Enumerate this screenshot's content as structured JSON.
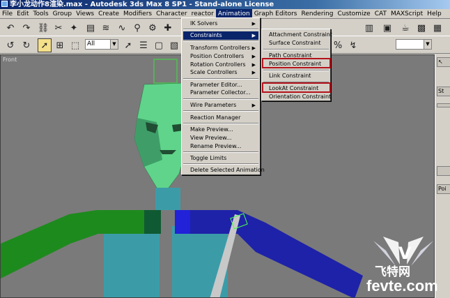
{
  "window": {
    "title": "李小龙动作8渲染.max - Autodesk 3ds Max 8 SP1 - Stand-alone License"
  },
  "menubar": {
    "items": [
      "File",
      "Edit",
      "Tools",
      "Group",
      "Views",
      "Create",
      "Modifiers",
      "Character",
      "reactor",
      "Animation",
      "Graph Editors",
      "Rendering",
      "Customize",
      "CAT",
      "MAXScript",
      "Help"
    ],
    "active": "Animation"
  },
  "toolbar": {
    "selection_filter": "All"
  },
  "viewport": {
    "label": "Front"
  },
  "animation_menu": {
    "items": [
      "IK Solvers",
      "Constraints",
      "Transform Controllers",
      "Position Controllers",
      "Rotation Controllers",
      "Scale Controllers",
      "Parameter Editor...",
      "Parameter Collector...",
      "Wire Parameters",
      "Reaction Manager",
      "Make Preview...",
      "View Preview...",
      "Rename Preview...",
      "Toggle Limits",
      "Delete Selected Animation"
    ]
  },
  "constraints_submenu": {
    "items": [
      "Attachment Constraint",
      "Surface Constraint",
      "Path Constraint",
      "Position Constraint",
      "Link Constraint",
      "LookAt Constraint",
      "Orientation Constraint"
    ],
    "highlighted": [
      "Position Constraint",
      "LookAt Constraint"
    ]
  },
  "command_panel": {
    "tab_labels": [
      "St",
      "Poi"
    ]
  },
  "watermark": {
    "brand_cn": "飞特网",
    "brand_url": "fevte.com",
    "logo_letter": "V"
  },
  "colors": {
    "highlight_border": "#b3121b",
    "menu_selection": "#0a246a",
    "head": "#5fd48a",
    "arm_left": "#1d8a1d",
    "arm_right": "#1e22a8",
    "torso": "#3b9ca8"
  }
}
